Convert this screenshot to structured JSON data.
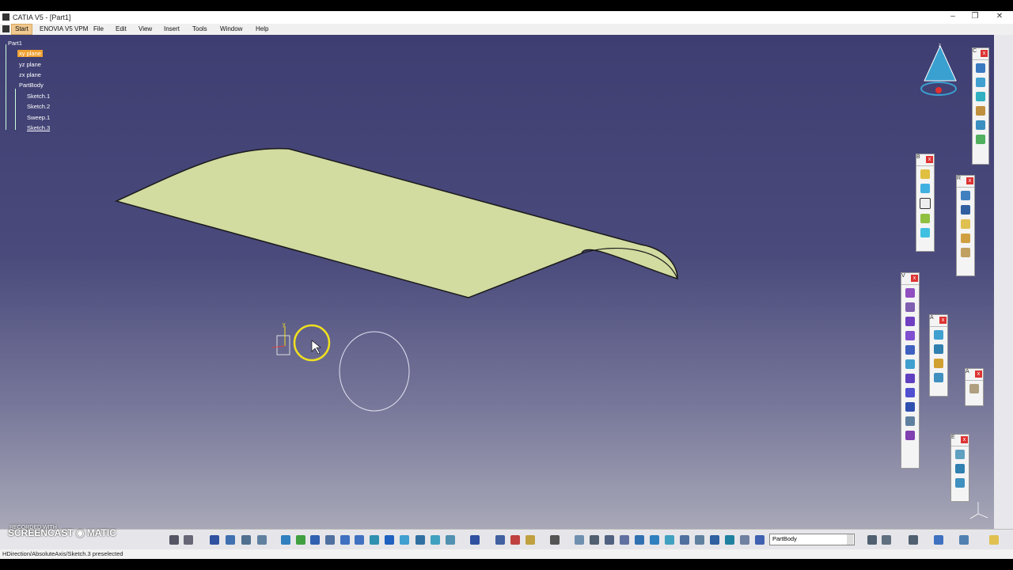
{
  "window": {
    "title": "CATIA V5 - [Part1]",
    "min": "–",
    "max": "❐",
    "close": "✕"
  },
  "menu": [
    "Start",
    "ENOVIA V5 VPM",
    "File",
    "Edit",
    "View",
    "Insert",
    "Tools",
    "Window",
    "Help"
  ],
  "tree": {
    "root": "Part1",
    "items": [
      "xy plane",
      "yz plane",
      "zx plane",
      "PartBody",
      "Sketch.1",
      "Sketch.2",
      "Sweep.1",
      "Sketch.3"
    ],
    "selected": "xy plane"
  },
  "toolbars": {
    "compass_box": "C",
    "b_box": "B",
    "r_box": "R",
    "v_box": "V",
    "a_box": "A",
    "a2_box": "A",
    "e_box": "E"
  },
  "compass_axis": "z",
  "sketch_axis": "y",
  "combo": {
    "value": "PartBody"
  },
  "status": "HDirection/AbsoluteAxis/Sketch.3 preselected",
  "watermark": {
    "top": "RECORDED WITH",
    "main": "SCREENCAST ◉ MATIC"
  },
  "colors": {
    "surface": "#d2dba0",
    "selection": "#f0a030",
    "cursor_ring": "#f0e020"
  }
}
